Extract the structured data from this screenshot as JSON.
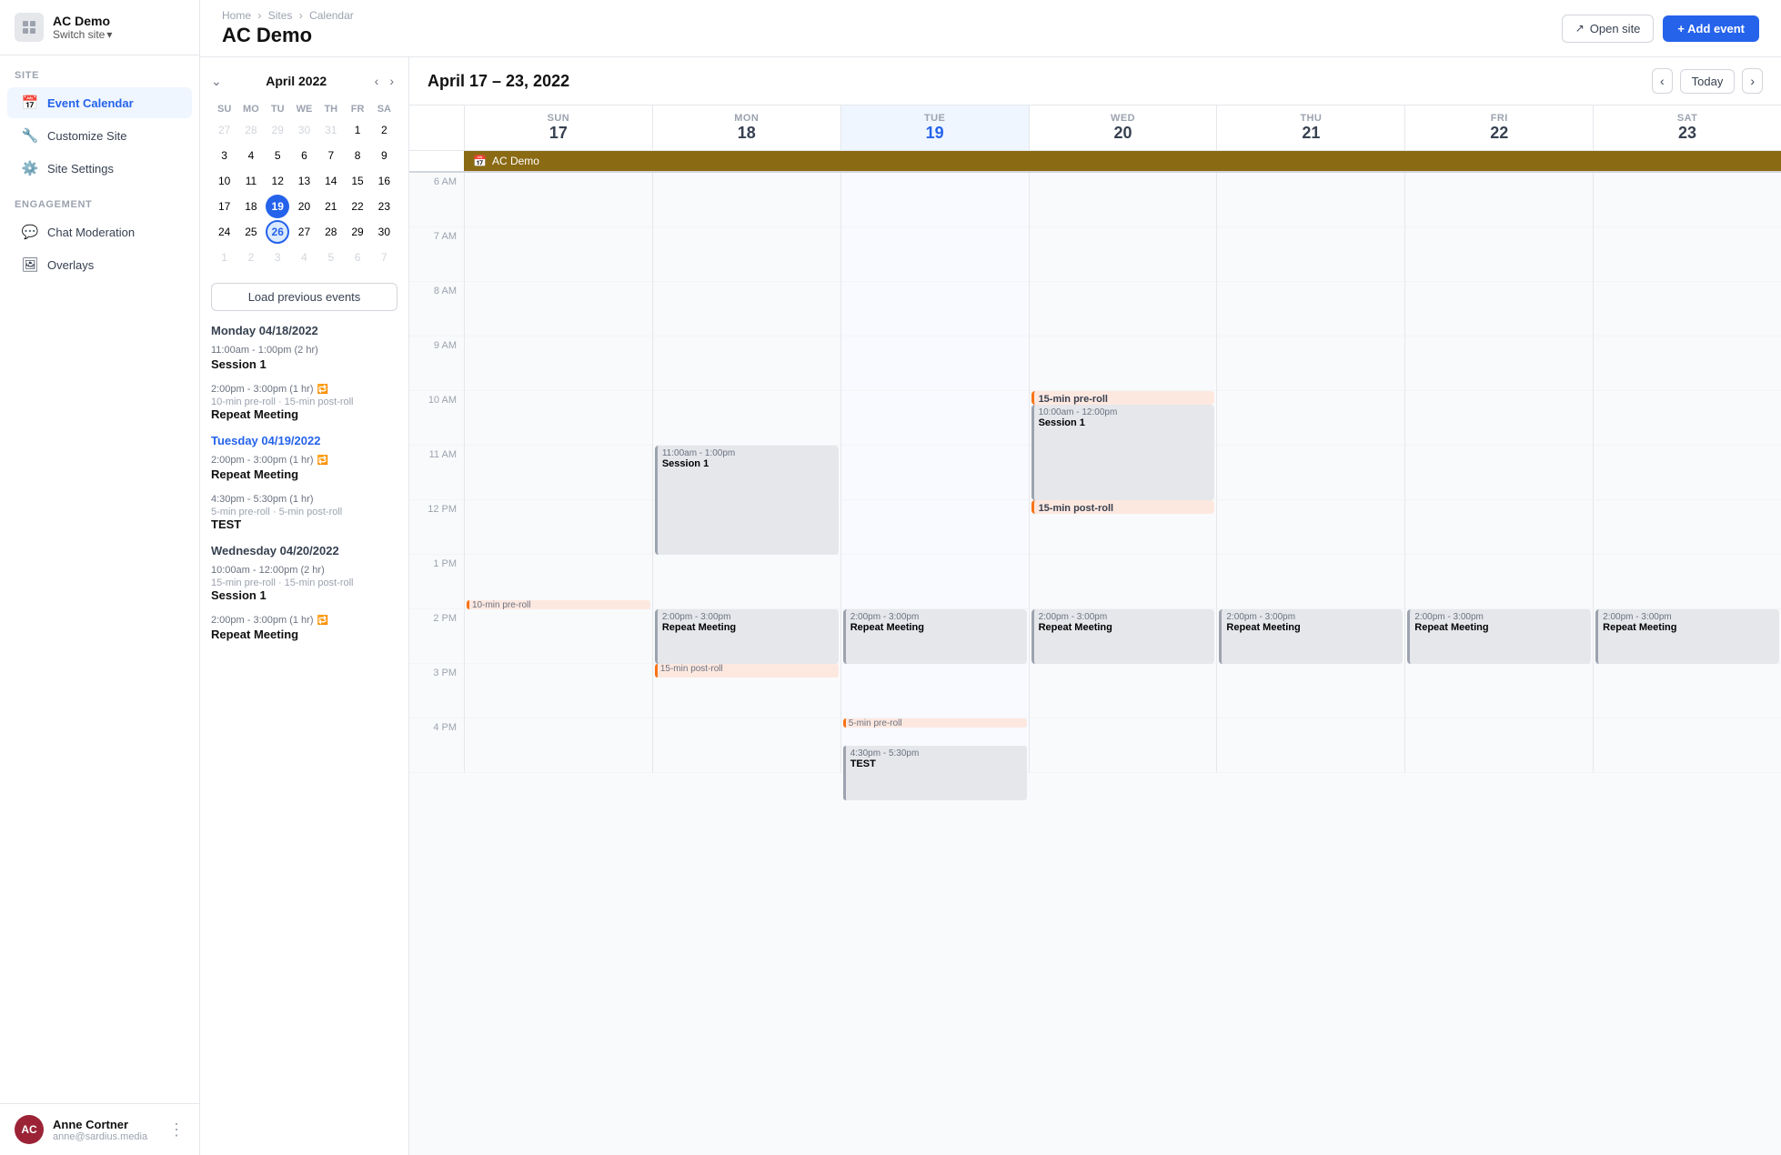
{
  "sidebar": {
    "brand": {
      "name": "AC Demo",
      "switch_label": "Switch site"
    },
    "sections": [
      {
        "label": "SITE",
        "items": [
          {
            "id": "event-calendar",
            "icon": "📅",
            "label": "Event Calendar",
            "active": true
          },
          {
            "id": "customize-site",
            "icon": "🔧",
            "label": "Customize Site",
            "active": false
          },
          {
            "id": "site-settings",
            "icon": "⚙️",
            "label": "Site Settings",
            "active": false
          }
        ]
      },
      {
        "label": "ENGAGEMENT",
        "items": [
          {
            "id": "chat-moderation",
            "icon": "💬",
            "label": "Chat Moderation",
            "active": false
          },
          {
            "id": "overlays",
            "icon": "🖼",
            "label": "Overlays",
            "active": false
          }
        ]
      }
    ],
    "user": {
      "initials": "AC",
      "name": "Anne Cortner",
      "email": "anne@sardius.media"
    }
  },
  "topbar": {
    "breadcrumb": [
      "Home",
      "Sites",
      "Calendar"
    ],
    "page_title": "AC Demo",
    "btn_open_site": "Open site",
    "btn_add_event": "+ Add event"
  },
  "mini_calendar": {
    "month_year": "April 2022",
    "day_headers": [
      "SU",
      "MO",
      "TU",
      "WE",
      "TH",
      "FR",
      "SA"
    ],
    "weeks": [
      [
        "27",
        "28",
        "29",
        "30",
        "31",
        "1",
        "2"
      ],
      [
        "3",
        "4",
        "5",
        "6",
        "7",
        "8",
        "9"
      ],
      [
        "10",
        "11",
        "12",
        "13",
        "14",
        "15",
        "16"
      ],
      [
        "17",
        "18",
        "19",
        "20",
        "21",
        "22",
        "23"
      ],
      [
        "24",
        "25",
        "26",
        "27",
        "28",
        "29",
        "30"
      ],
      [
        "1",
        "2",
        "3",
        "4",
        "5",
        "6",
        "7"
      ]
    ],
    "outside_days": {
      "w1": [
        0,
        1,
        2,
        3,
        4
      ],
      "w5": [],
      "w6": [
        0,
        1,
        2,
        3,
        4,
        5,
        6
      ]
    },
    "selected_day": "19",
    "range_day": "26",
    "load_prev_btn": "Load previous events"
  },
  "event_list": {
    "days": [
      {
        "label": "Monday 04/18/2022",
        "style": "normal",
        "events": [
          {
            "time": "11:00am - 1:00pm (2 hr)",
            "pre_post": "",
            "name": "Session 1",
            "repeat": false
          },
          {
            "time": "2:00pm - 3:00pm (1 hr)",
            "pre_post": "10-min pre-roll · 15-min post-roll",
            "name": "Repeat Meeting",
            "repeat": true
          }
        ]
      },
      {
        "label": "Tuesday 04/19/2022",
        "style": "tuesday",
        "events": [
          {
            "time": "2:00pm - 3:00pm (1 hr)",
            "pre_post": "",
            "name": "Repeat Meeting",
            "repeat": true
          },
          {
            "time": "4:30pm - 5:30pm (1 hr)",
            "pre_post": "5-min pre-roll · 5-min post-roll",
            "name": "TEST",
            "repeat": false
          }
        ]
      },
      {
        "label": "Wednesday 04/20/2022",
        "style": "normal",
        "events": [
          {
            "time": "10:00am - 12:00pm (2 hr)",
            "pre_post": "15-min pre-roll · 15-min post-roll",
            "name": "Session 1",
            "repeat": false
          },
          {
            "time": "2:00pm - 3:00pm (1 hr)",
            "pre_post": "",
            "name": "Repeat Meeting",
            "repeat": true
          }
        ]
      }
    ]
  },
  "calendar": {
    "week_title": "April 17 – 23, 2022",
    "btn_today": "Today",
    "day_headers": [
      {
        "abbr": "SUN",
        "num": "17",
        "today": false
      },
      {
        "abbr": "MON",
        "num": "18",
        "today": false
      },
      {
        "abbr": "TUE",
        "num": "19",
        "today": true
      },
      {
        "abbr": "WED",
        "num": "20",
        "today": false
      },
      {
        "abbr": "THU",
        "num": "21",
        "today": false
      },
      {
        "abbr": "FRI",
        "num": "22",
        "today": false
      },
      {
        "abbr": "SAT",
        "num": "23",
        "today": false
      }
    ],
    "allday_event": "📅 AC Demo",
    "time_slots": [
      "6 AM",
      "7 AM",
      "8 AM",
      "9 AM",
      "10 AM",
      "11 AM",
      "12 PM",
      "1 PM",
      "2 PM",
      "3 PM",
      "4 PM"
    ],
    "events": {
      "mon": [
        {
          "name": "Session 1",
          "time": "11:00am - 1:00pm",
          "top_pct": 83,
          "height_pct": 33,
          "style": "gray"
        }
      ],
      "tue": [
        {
          "name": "Repeat Meeting",
          "time": "2:00pm - 3:00pm",
          "top_pct": 133,
          "height_pct": 17,
          "style": "gray"
        }
      ],
      "wed": [
        {
          "name": "15-min pre-roll",
          "time": "",
          "top_pct": 67,
          "height_pct": 4,
          "style": "salmon"
        },
        {
          "name": "Session 1",
          "time": "10:00am - 12:00pm",
          "top_pct": 67,
          "height_pct": 33,
          "style": "light-gray"
        },
        {
          "name": "15-min post-roll",
          "time": "",
          "top_pct": 100,
          "height_pct": 4,
          "style": "salmon"
        },
        {
          "name": "Repeat Meeting",
          "time": "2:00pm - 3:00pm",
          "top_pct": 133,
          "height_pct": 17,
          "style": "gray"
        }
      ],
      "thu": [
        {
          "name": "Repeat Meeting",
          "time": "2:00pm - 3:00pm",
          "top_pct": 133,
          "height_pct": 17,
          "style": "gray"
        }
      ],
      "fri": [
        {
          "name": "Repeat Meeting",
          "time": "2:00pm - 3:00pm",
          "top_pct": 133,
          "height_pct": 17,
          "style": "gray"
        }
      ],
      "sat": [
        {
          "name": "Repeat Meeting",
          "time": "2:00pm - 3:00pm",
          "top_pct": 133,
          "height_pct": 17,
          "style": "gray"
        }
      ]
    }
  }
}
